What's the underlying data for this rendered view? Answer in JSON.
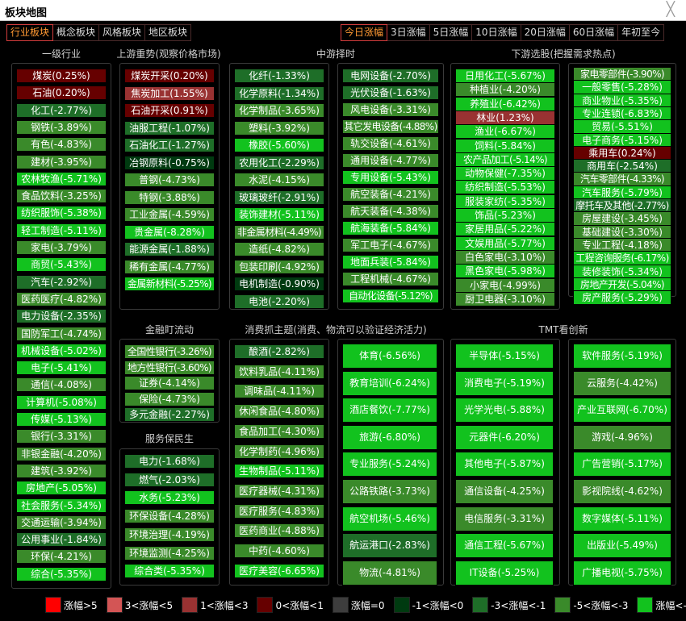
{
  "window": {
    "title": "板块地图",
    "close_glyph": "╳"
  },
  "tabs_left": [
    "行业板块",
    "概念板块",
    "风格板块",
    "地区板块"
  ],
  "tabs_left_active": 0,
  "tabs_right": [
    "今日涨幅",
    "3日涨幅",
    "5日涨幅",
    "10日涨幅",
    "20日涨幅",
    "60日涨幅",
    "年初至今"
  ],
  "tabs_right_active": 0,
  "colors": {
    "r_hi": "#ff0000",
    "r_mid": "#d35555",
    "r_lo": "#993232",
    "r_min": "#660000",
    "flat": "#3d3d3d",
    "g_min": "#003a10",
    "g_lo": "#1e6e28",
    "g_mid": "#3a8a2a",
    "g_hi": "#12c21e"
  },
  "legend": [
    {
      "color": "r_hi",
      "label": "涨幅>5"
    },
    {
      "color": "r_mid",
      "label": "3<涨幅<5"
    },
    {
      "color": "r_lo",
      "label": "1<涨幅<3"
    },
    {
      "color": "r_min",
      "label": "0<涨幅<1"
    },
    {
      "color": "flat",
      "label": "涨幅=0"
    },
    {
      "color": "g_min",
      "label": "-1<涨幅<0"
    },
    {
      "color": "g_lo",
      "label": "-3<涨幅<-1"
    },
    {
      "color": "g_mid",
      "label": "-5<涨幅<-3"
    },
    {
      "color": "g_hi",
      "label": "涨幅<-5"
    }
  ],
  "groups": [
    {
      "id": "yiji",
      "heading": "一级行业",
      "items": [
        {
          "name": "煤炭",
          "value": 0.25
        },
        {
          "name": "石油",
          "value": 0.2
        },
        {
          "name": "化工",
          "value": -2.77
        },
        {
          "name": "钢铁",
          "value": -3.89
        },
        {
          "name": "有色",
          "value": -4.83
        },
        {
          "name": "建材",
          "value": -3.95
        },
        {
          "name": "农林牧渔",
          "value": -5.71
        },
        {
          "name": "食品饮料",
          "value": -3.25
        },
        {
          "name": "纺织服饰",
          "value": -5.38
        },
        {
          "name": "轻工制造",
          "value": -5.11
        },
        {
          "name": "家电",
          "value": -3.79
        },
        {
          "name": "商贸",
          "value": -5.43
        },
        {
          "name": "汽车",
          "value": -2.92
        },
        {
          "name": "医药医疗",
          "value": -4.82
        },
        {
          "name": "电力设备",
          "value": -2.35
        },
        {
          "name": "国防军工",
          "value": -4.74
        },
        {
          "name": "机械设备",
          "value": -5.02
        },
        {
          "name": "电子",
          "value": -5.41
        },
        {
          "name": "通信",
          "value": -4.08
        },
        {
          "name": "计算机",
          "value": -5.08
        },
        {
          "name": "传媒",
          "value": -5.13
        },
        {
          "name": "银行",
          "value": -3.31
        },
        {
          "name": "非银金融",
          "value": -4.2
        },
        {
          "name": "建筑",
          "value": -3.92
        },
        {
          "name": "房地产",
          "value": -5.05
        },
        {
          "name": "社会服务",
          "value": -5.34
        },
        {
          "name": "交通运输",
          "value": -3.94
        },
        {
          "name": "公用事业",
          "value": -1.84
        },
        {
          "name": "环保",
          "value": -4.21
        },
        {
          "name": "综合",
          "value": -5.35
        }
      ]
    },
    {
      "id": "shangyou",
      "heading": "上游重势(观察价格市场)",
      "items": [
        {
          "name": "煤炭开采",
          "value": 0.2
        },
        {
          "name": "焦炭加工",
          "value": 1.55
        },
        {
          "name": "石油开采",
          "value": 0.91
        },
        {
          "name": "油服工程",
          "value": -1.07
        },
        {
          "name": "石油化工",
          "value": -1.27
        },
        {
          "name": "冶钢原料",
          "value": -0.75
        },
        {
          "name": "普钢",
          "value": -4.73
        },
        {
          "name": "特钢",
          "value": -3.88
        },
        {
          "name": "工业金属",
          "value": -4.59
        },
        {
          "name": "贵金属",
          "value": -8.28
        },
        {
          "name": "能源金属",
          "value": -1.88
        },
        {
          "name": "稀有金属",
          "value": -4.77
        },
        {
          "name": "金属新材料",
          "value": -5.25
        }
      ]
    },
    {
      "id": "zhongyou_a",
      "heading": "中游择时",
      "items": [
        {
          "name": "化纤",
          "value": -1.33
        },
        {
          "name": "化学原料",
          "value": -1.34
        },
        {
          "name": "化学制品",
          "value": -3.65
        },
        {
          "name": "塑料",
          "value": -3.92
        },
        {
          "name": "橡胶",
          "value": -5.6
        },
        {
          "name": "农用化工",
          "value": -2.29
        },
        {
          "name": "水泥",
          "value": -4.15
        },
        {
          "name": "玻璃玻纤",
          "value": -2.91
        },
        {
          "name": "装饰建材",
          "value": -5.11
        },
        {
          "name": "非金属材料",
          "value": -4.49
        },
        {
          "name": "造纸",
          "value": -4.82
        },
        {
          "name": "包装印刷",
          "value": -4.92
        },
        {
          "name": "电机制造",
          "value": -0.9
        },
        {
          "name": "电池",
          "value": -2.2
        }
      ]
    },
    {
      "id": "zhongyou_b",
      "heading": "",
      "items": [
        {
          "name": "电网设备",
          "value": -2.7
        },
        {
          "name": "光伏设备",
          "value": -1.63
        },
        {
          "name": "风电设备",
          "value": -3.31
        },
        {
          "name": "其它发电设备",
          "value": -4.88
        },
        {
          "name": "轨交设备",
          "value": -4.61
        },
        {
          "name": "通用设备",
          "value": -4.77
        },
        {
          "name": "专用设备",
          "value": -5.43
        },
        {
          "name": "航空装备",
          "value": -4.21
        },
        {
          "name": "航天装备",
          "value": -4.38
        },
        {
          "name": "航海装备",
          "value": -5.84
        },
        {
          "name": "军工电子",
          "value": -4.67
        },
        {
          "name": "地面兵装",
          "value": -5.84
        },
        {
          "name": "工程机械",
          "value": -4.67
        },
        {
          "name": "自动化设备",
          "value": -5.12
        }
      ]
    },
    {
      "id": "xiayou_a",
      "heading": "下游选股(把握需求热点)",
      "items": [
        {
          "name": "日用化工",
          "value": -5.67
        },
        {
          "name": "种植业",
          "value": -4.2
        },
        {
          "name": "养殖业",
          "value": -6.42
        },
        {
          "name": "林业",
          "value": 1.23
        },
        {
          "name": "渔业",
          "value": -6.67
        },
        {
          "name": "饲料",
          "value": -5.84
        },
        {
          "name": "农产品加工",
          "value": -5.14
        },
        {
          "name": "动物保健",
          "value": -7.35
        },
        {
          "name": "纺织制造",
          "value": -5.53
        },
        {
          "name": "服装家纺",
          "value": -5.35
        },
        {
          "name": "饰品",
          "value": -5.23
        },
        {
          "name": "家居用品",
          "value": -5.22
        },
        {
          "name": "文娱用品",
          "value": -5.77
        },
        {
          "name": "白色家电",
          "value": -3.1
        },
        {
          "name": "黑色家电",
          "value": -5.98
        },
        {
          "name": "小家电",
          "value": -4.99
        },
        {
          "name": "厨卫电器",
          "value": -3.1
        }
      ]
    },
    {
      "id": "xiayou_b",
      "heading": "",
      "items": [
        {
          "name": "家电零部件",
          "value": -3.9
        },
        {
          "name": "一般零售",
          "value": -5.28
        },
        {
          "name": "商业物业",
          "value": -5.35
        },
        {
          "name": "专业连锁",
          "value": -6.83
        },
        {
          "name": "贸易",
          "value": -5.51
        },
        {
          "name": "电子商务",
          "value": -5.15
        },
        {
          "name": "乘用车",
          "value": 0.24
        },
        {
          "name": "商用车",
          "value": -2.54
        },
        {
          "name": "汽车零部件",
          "value": -4.33
        },
        {
          "name": "汽车服务",
          "value": -5.79
        },
        {
          "name": "摩托车及其他",
          "value": -2.77
        },
        {
          "name": "房屋建设",
          "value": -3.45
        },
        {
          "name": "基础建设",
          "value": -3.3
        },
        {
          "name": "专业工程",
          "value": -4.18
        },
        {
          "name": "工程咨询服务",
          "value": -6.17
        },
        {
          "name": "装修装饰",
          "value": -5.34
        },
        {
          "name": "房地产开发",
          "value": -5.04
        },
        {
          "name": "房产服务",
          "value": -5.29
        }
      ]
    },
    {
      "id": "jinrong",
      "heading": "金融盯流动",
      "items": [
        {
          "name": "全国性银行",
          "value": -3.26
        },
        {
          "name": "地方性银行",
          "value": -3.6
        },
        {
          "name": "证券",
          "value": -4.14
        },
        {
          "name": "保险",
          "value": -4.73
        },
        {
          "name": "多元金融",
          "value": -2.27
        }
      ]
    },
    {
      "id": "fuwu",
      "heading": "服务保民生",
      "items": [
        {
          "name": "电力",
          "value": -1.68
        },
        {
          "name": "燃气",
          "value": -2.03
        },
        {
          "name": "水务",
          "value": -5.23
        },
        {
          "name": "环保设备",
          "value": -4.28
        },
        {
          "name": "环境治理",
          "value": -4.19
        },
        {
          "name": "环境监测",
          "value": -4.25
        },
        {
          "name": "综合类",
          "value": -5.35
        }
      ]
    },
    {
      "id": "xiaofei_a",
      "heading": "消费抓主题(消费、物流可以验证经济活力)",
      "items": [
        {
          "name": "酿酒",
          "value": -2.82
        },
        {
          "name": "饮料乳品",
          "value": -4.11
        },
        {
          "name": "调味品",
          "value": -4.11
        },
        {
          "name": "休闲食品",
          "value": -4.8
        },
        {
          "name": "食品加工",
          "value": -4.3
        },
        {
          "name": "化学制药",
          "value": -4.96
        },
        {
          "name": "生物制品",
          "value": -5.11
        },
        {
          "name": "医疗器械",
          "value": -4.31
        },
        {
          "name": "医疗服务",
          "value": -4.83
        },
        {
          "name": "医药商业",
          "value": -4.88
        },
        {
          "name": "中药",
          "value": -4.6
        },
        {
          "name": "医疗美容",
          "value": -6.65
        }
      ]
    },
    {
      "id": "xiaofei_b",
      "heading": "",
      "items": [
        {
          "name": "体育",
          "value": -6.56
        },
        {
          "name": "教育培训",
          "value": -6.24
        },
        {
          "name": "酒店餐饮",
          "value": -7.77
        },
        {
          "name": "旅游",
          "value": -6.8
        },
        {
          "name": "专业服务",
          "value": -5.24
        },
        {
          "name": "公路铁路",
          "value": -3.73
        },
        {
          "name": "航空机场",
          "value": -5.46
        },
        {
          "name": "航运港口",
          "value": -2.83
        },
        {
          "name": "物流",
          "value": -4.81
        }
      ]
    },
    {
      "id": "tmt_a",
      "heading": "TMT看创新",
      "items": [
        {
          "name": "半导体",
          "value": -5.15
        },
        {
          "name": "消费电子",
          "value": -5.19
        },
        {
          "name": "光学光电",
          "value": -5.88
        },
        {
          "name": "元器件",
          "value": -6.2
        },
        {
          "name": "其他电子",
          "value": -5.87
        },
        {
          "name": "通信设备",
          "value": -4.25
        },
        {
          "name": "电信服务",
          "value": -3.31
        },
        {
          "name": "通信工程",
          "value": -5.67
        },
        {
          "name": "IT设备",
          "value": -5.25
        }
      ]
    },
    {
      "id": "tmt_b",
      "heading": "",
      "items": [
        {
          "name": "软件服务",
          "value": -5.19
        },
        {
          "name": "云服务",
          "value": -4.42
        },
        {
          "name": "产业互联网",
          "value": -6.7
        },
        {
          "name": "游戏",
          "value": -4.96
        },
        {
          "name": "广告营销",
          "value": -5.17
        },
        {
          "name": "影视院线",
          "value": -4.62
        },
        {
          "name": "数字媒体",
          "value": -5.11
        },
        {
          "name": "出版业",
          "value": -5.49
        },
        {
          "name": "广播电视",
          "value": -5.75
        }
      ]
    }
  ]
}
